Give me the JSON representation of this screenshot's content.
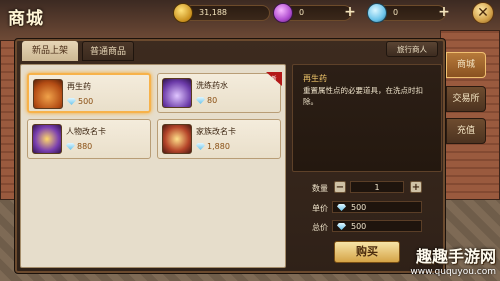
{
  "header": {
    "title": "商城"
  },
  "currencies": [
    {
      "icon": "gold-coin-icon",
      "value": "31,188"
    },
    {
      "icon": "purple-gem-icon",
      "value": "0"
    },
    {
      "icon": "diamond-icon",
      "value": "0"
    }
  ],
  "tabs": [
    {
      "label": "新品上架",
      "active": true
    },
    {
      "label": "普通商品",
      "active": false
    }
  ],
  "merchant_button": "旅行商人",
  "items": [
    {
      "name": "再生药",
      "price": "500",
      "icon": "regen-potion-icon",
      "selected": true,
      "badge": ""
    },
    {
      "name": "洗练药水",
      "price": "80",
      "icon": "refine-potion-icon",
      "selected": false,
      "badge": "新"
    },
    {
      "name": "人物改名卡",
      "price": "880",
      "icon": "rename-card-icon",
      "selected": false,
      "badge": ""
    },
    {
      "name": "家族改名卡",
      "price": "1,880",
      "icon": "family-rename-card-icon",
      "selected": false,
      "badge": ""
    }
  ],
  "detail": {
    "name": "再生药",
    "description": "重置属性点的必要道具，在洗点时扣除。"
  },
  "purchase": {
    "quantity_label": "数量",
    "quantity": "1",
    "unit_price_label": "单价",
    "unit_price": "500",
    "total_label": "总价",
    "total": "500",
    "buy_label": "购买"
  },
  "side_tabs": [
    {
      "label": "商城",
      "active": true
    },
    {
      "label": "交易所",
      "active": false
    },
    {
      "label": "充值",
      "active": false
    }
  ],
  "watermark": {
    "line1": "趣趣手游网",
    "line2": "www.ququyou.com"
  },
  "colors": {
    "accent": "#f7b24a",
    "price_text": "#8a4f13",
    "panel_bg": "#2f2118"
  }
}
